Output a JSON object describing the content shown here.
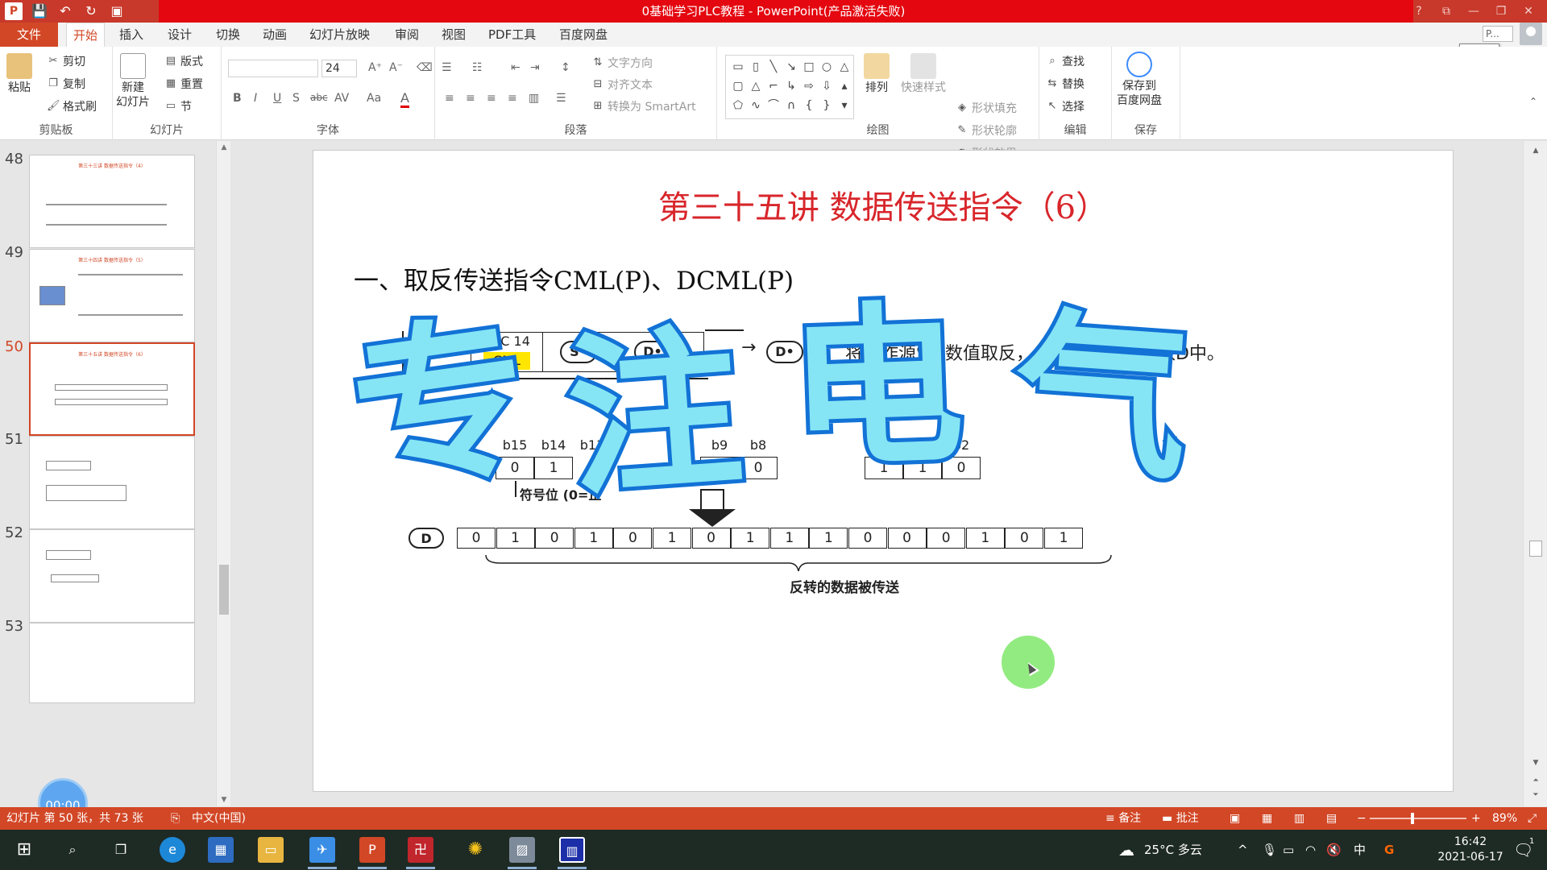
{
  "window": {
    "title": "0基础学习PLC教程 - PowerPoint(产品激活失败)",
    "help": "?",
    "controls": [
      "⧉",
      "—",
      "❐",
      "✕"
    ]
  },
  "qat": {
    "app_logo": "P",
    "save": "💾",
    "undo": "↶",
    "redo": "↻",
    "present": "▣"
  },
  "tabs": {
    "file": "文件",
    "items": [
      "开始",
      "插入",
      "设计",
      "切换",
      "动画",
      "幻灯片放映",
      "审阅",
      "视图",
      "PDF工具",
      "百度网盘"
    ],
    "active": "开始"
  },
  "account": {
    "box_text": "P...",
    "tooltip": "开始"
  },
  "ribbon": {
    "clipboard": {
      "label": "剪贴板",
      "paste": "粘贴",
      "cut": "剪切",
      "copy": "复制",
      "format_painter": "格式刷"
    },
    "slides": {
      "label": "幻灯片",
      "new_slide_line1": "新建",
      "new_slide_line2": "幻灯片",
      "layout": "版式",
      "reset": "重置",
      "section": "节"
    },
    "font": {
      "label": "字体",
      "font_name": "",
      "font_size": "24",
      "bold": "B",
      "italic": "I",
      "underline": "U",
      "shadow": "S",
      "strike": "abc",
      "spacing": "AV",
      "case": "Aa",
      "color": "A"
    },
    "paragraph": {
      "label": "段落",
      "text_direction": "文字方向",
      "align_text": "对齐文本",
      "smartart": "转换为 SmartArt"
    },
    "drawing": {
      "label": "绘图",
      "arrange": "排列",
      "quick_styles": "快速样式",
      "shape_fill": "形状填充",
      "shape_outline": "形状轮廓",
      "shape_effects": "形状效果"
    },
    "editing": {
      "label": "编辑",
      "find": "查找",
      "replace": "替换",
      "select": "选择"
    },
    "save": {
      "label": "保存",
      "save_line1": "保存到",
      "save_line2": "百度网盘"
    }
  },
  "thumbnails": [
    {
      "num": "48",
      "title": "第三十三讲 数据传送指令（4）"
    },
    {
      "num": "49",
      "title": "第三十四讲 数据传送指令（5）"
    },
    {
      "num": "50",
      "title": "第三十五讲 数据传送指令（6）",
      "active": true
    },
    {
      "num": "51",
      "title": ""
    },
    {
      "num": "52",
      "title": ""
    },
    {
      "num": "53",
      "title": ""
    }
  ],
  "timer": "00:00",
  "slide": {
    "title": "第三十五讲 数据传送指令（6）",
    "subtitle": "一、取反传送指令CML(P)、DCML(P)",
    "instr_label": "指令",
    "fnc": "FNC 14",
    "cml": "CML",
    "s_operand": "S•",
    "d_operand": "D•",
    "arrow": "→",
    "d_label": "D",
    "description": "将操作源S的数值取反，然后传送到目标数D中。",
    "sign_bit_note": "符号位 (0=正",
    "bit_labels": [
      "b15",
      "b14",
      "b13",
      "b9",
      "b8",
      "b4",
      "b3",
      "b2"
    ],
    "source_bits": [
      "0",
      "1",
      "1",
      "0"
    ],
    "source_bits_right": [
      "1",
      "1",
      "0"
    ],
    "dest_bits": [
      "0",
      "1",
      "0",
      "1",
      "0",
      "1",
      "0",
      "1",
      "1",
      "1",
      "0",
      "0",
      "0",
      "1",
      "0",
      "1"
    ],
    "result_caption": "反转的数据被传送",
    "watermark": [
      "专",
      "注",
      "电",
      "气"
    ]
  },
  "statusbar": {
    "slide_info": "幻灯片 第 50 张，共 73 张",
    "language": "中文(中国)",
    "notes": "备注",
    "comments": "批注",
    "zoom": "89%"
  },
  "taskbar": {
    "weather": "25°C 多云",
    "ime": "中",
    "time": "16:42",
    "date": "2021-06-17",
    "notify_count": "1"
  },
  "colors": {
    "title_red": "#e4070f",
    "accent": "#d24726",
    "slide_title": "#d8262b",
    "watermark_fill": "#86e5f4",
    "watermark_stroke": "#1272d6"
  }
}
